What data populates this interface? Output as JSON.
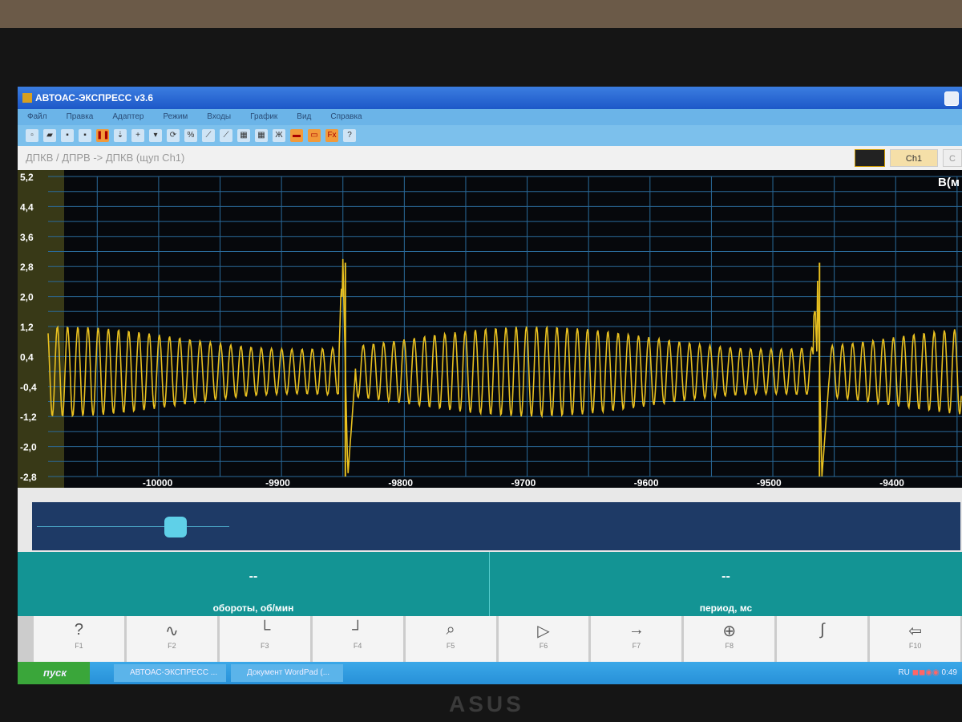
{
  "window": {
    "title": "АВТОАС-ЭКСПРЕСС v3.6"
  },
  "menu": [
    "Файл",
    "Правка",
    "Адаптер",
    "Режим",
    "Входы",
    "График",
    "Вид",
    "Справка"
  ],
  "toolbar": {
    "bold_label": "Ж",
    "fx_label": "Fx"
  },
  "path": "ДПКВ / ДПРВ -> ДПКВ (щуп Ch1)",
  "channel": {
    "label": "Ch1",
    "next": "C"
  },
  "units": "В(м",
  "chart_data": {
    "type": "line",
    "title": "ДПКВ / ДПРВ -> ДПКВ (щуп Ch1)",
    "xlabel": "",
    "ylabel": "В",
    "xlim": [
      -10090,
      -9346
    ],
    "ylim": [
      -2.8,
      5.2
    ],
    "x_ticks": [
      "-10000",
      "-9900",
      "-9800",
      "-9700",
      "-9600",
      "-9500",
      "-9400"
    ],
    "y_ticks": [
      "5,2",
      "4,4",
      "3,6",
      "2,8",
      "2,0",
      "1,2",
      "0,4",
      "-0,4",
      "-1,2",
      "-2,0",
      "-2,8"
    ],
    "grid": true,
    "series": [
      {
        "name": "Ch1",
        "color": "#e8c020",
        "cycle_period": 8.3,
        "amplitude_range": [
          0.6,
          1.2
        ],
        "sync_spikes": [
          {
            "x": -9848,
            "max": 3.0,
            "min": -2.8
          },
          {
            "x": -9462,
            "max": 3.0,
            "min": -2.8
          }
        ]
      }
    ]
  },
  "readouts": [
    {
      "value": "--",
      "label": "обороты, об/мин"
    },
    {
      "value": "--",
      "label": "период, мс"
    }
  ],
  "fkeys": [
    {
      "icon": "help-icon",
      "glyph": "?",
      "label": "F1"
    },
    {
      "icon": "sine-icon",
      "glyph": "∿",
      "label": "F2"
    },
    {
      "icon": "x-axis-icon",
      "glyph": "└",
      "label": "F3"
    },
    {
      "icon": "y-axis-icon",
      "glyph": "┘",
      "label": "F4"
    },
    {
      "icon": "probe-icon",
      "glyph": "⌕",
      "label": "F5"
    },
    {
      "icon": "play-trigger-icon",
      "glyph": "▷",
      "label": "F6"
    },
    {
      "icon": "arrow-right-icon",
      "glyph": "→",
      "label": "F7"
    },
    {
      "icon": "crosshair-icon",
      "glyph": "⊕",
      "label": "F8"
    },
    {
      "icon": "step-icon",
      "glyph": "∫",
      "label": ""
    },
    {
      "icon": "exit-icon",
      "glyph": "⇦",
      "label": "F10"
    }
  ],
  "taskbar": {
    "start": "пуск",
    "tasks": [
      "АВТОАС-ЭКСПРЕСС ...",
      "Документ WordPad (..."
    ],
    "lang": "RU",
    "clock": "0:49"
  },
  "brand": "ASUS"
}
